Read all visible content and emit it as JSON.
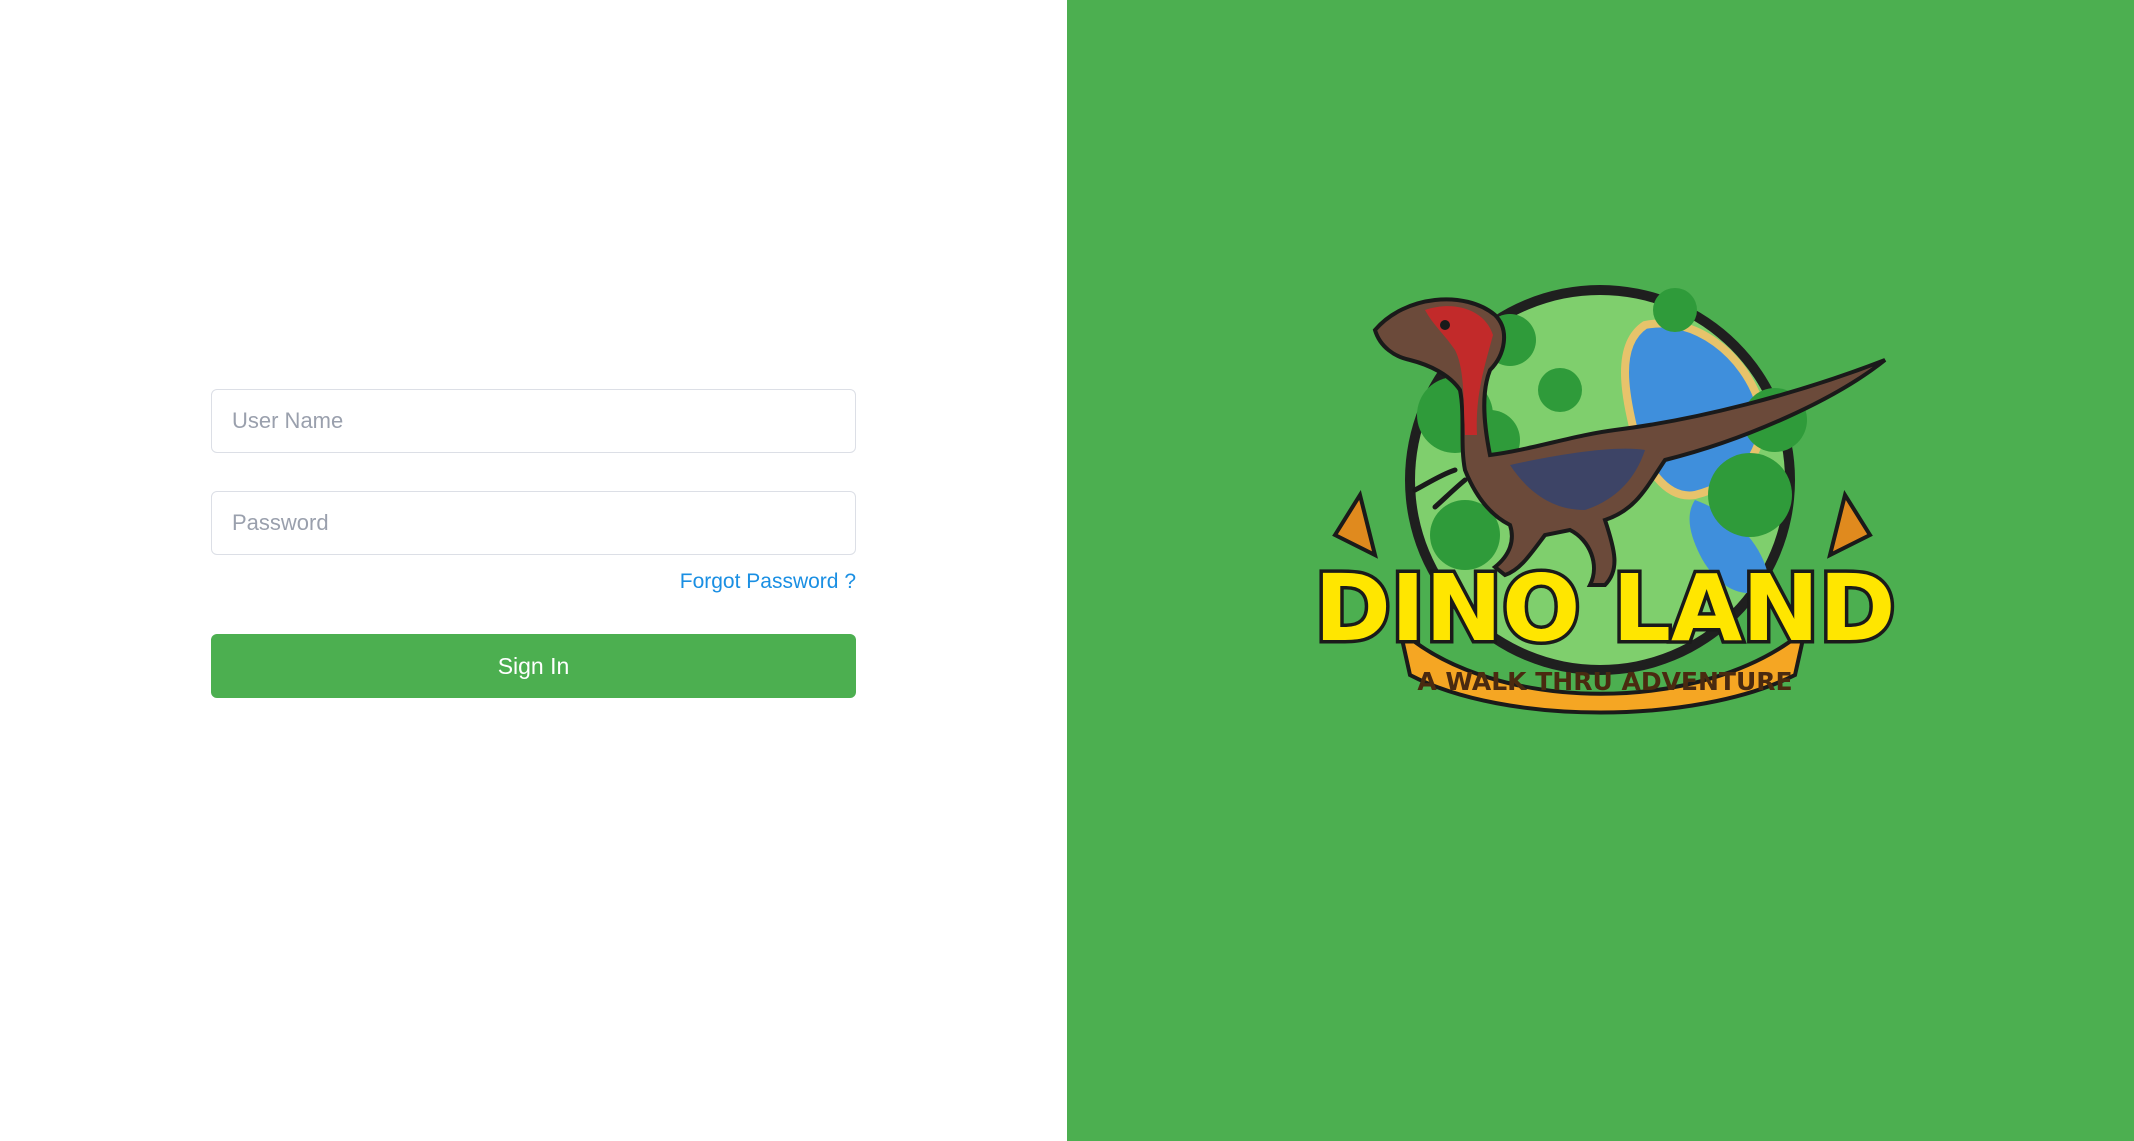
{
  "login": {
    "username_placeholder": "User Name",
    "password_placeholder": "Password",
    "forgot_password_label": "Forgot Password ?",
    "signin_label": "Sign In"
  },
  "brand": {
    "logo_title": "DINO LAND",
    "logo_tagline": "A WALK THRU ADVENTURE",
    "logo_icon": "dinosaur-globe-logo"
  },
  "colors": {
    "accent_green": "#4caf50",
    "link_blue": "#1a8fe3",
    "logo_yellow": "#ffe600",
    "logo_banner": "#f5a623"
  }
}
